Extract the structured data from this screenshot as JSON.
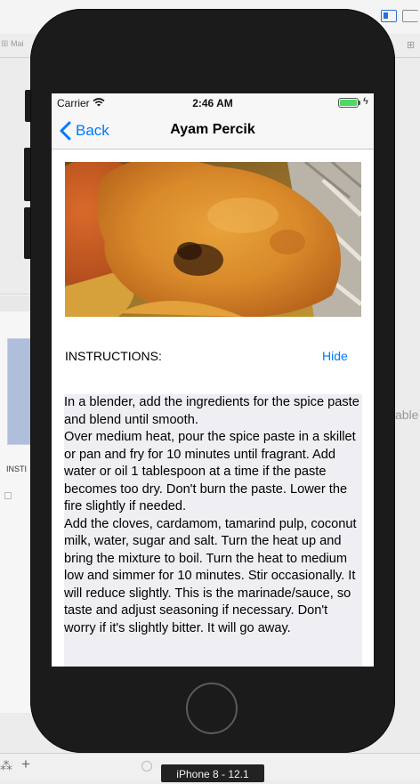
{
  "xcode": {
    "tab_main_label": "Mai",
    "side_label": "INSTI",
    "right_partial_label": "able",
    "device_label": "iPhone 8 - 12.1"
  },
  "status_bar": {
    "carrier": "Carrier",
    "time": "2:46 AM",
    "battery_level": 1.0
  },
  "nav": {
    "back_label": "Back",
    "title": "Ayam Percik"
  },
  "instructions": {
    "label": "INSTRUCTIONS:",
    "hide_label": "Hide",
    "text": "In a blender, add the ingredients for the spice paste and blend until smooth.\nOver medium heat, pour the spice paste in a skillet or pan and fry for 10 minutes until fragrant. Add water or oil 1 tablespoon at a time if the paste becomes too dry. Don't burn the paste. Lower the fire slightly if needed.\nAdd the cloves, cardamom, tamarind pulp, coconut milk, water, sugar and salt. Turn the heat up and bring the mixture to boil. Turn the heat to medium low and simmer for 10 minutes. Stir occasionally. It will reduce slightly. This is the marinade/sauce, so taste and adjust seasoning if necessary. Don't worry if it's slightly bitter. It will go away."
  },
  "colors": {
    "accent": "#007aff",
    "battery": "#4cd964",
    "text_background": "#eeeef3",
    "phone_body": "#1b1b1b"
  },
  "icons": {
    "back": "chevron-left-icon",
    "wifi": "wifi-icon",
    "battery": "battery-icon",
    "charging": "charging-bolt-icon",
    "home": "home-button-icon"
  }
}
